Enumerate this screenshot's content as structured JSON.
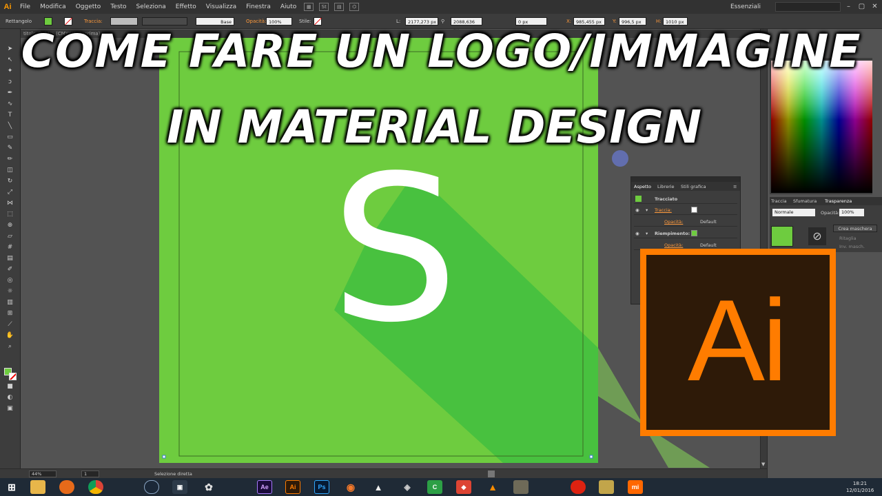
{
  "app": {
    "logo": "Ai"
  },
  "menu": [
    "File",
    "Modifica",
    "Oggetto",
    "Testo",
    "Seleziona",
    "Effetto",
    "Visualizza",
    "Finestra",
    "Aiuto"
  ],
  "workspace": "Essenziali",
  "control": {
    "tool_name": "Rettangolo",
    "stroke_label": "Traccia:",
    "brush_label": "Base",
    "opacity_label": "Opacità:",
    "opacity_value": "100%",
    "style_label": "Stile:",
    "width_label": "L:",
    "width_value": "2177,273 px",
    "height_value": "2088,636 px",
    "corner_value": "0 px",
    "x_label": "X:",
    "x_value": "985,455 px",
    "y_label": "Y:",
    "y_value": "996,5 px",
    "h_label": "H:",
    "h_value": "1010 px"
  },
  "tab": {
    "label": "titolo @ 44% (CMYK/Anteprima)"
  },
  "status": {
    "zoom": "44%",
    "page": "1",
    "selection": "Selezione diretta"
  },
  "appearance": {
    "tabs": [
      "Aspetto",
      "Librerie",
      "Stili grafica"
    ],
    "object": "Tracciato",
    "stroke": "Traccia:",
    "opacity": "Opacità:",
    "opacity_value": "Default",
    "fill": "Riempimento:",
    "opacity2": "Opacità:",
    "opacity2_value": "Default"
  },
  "transparency": {
    "tabs": [
      "Traccia",
      "Sfumatura",
      "Trasparenza"
    ],
    "mode": "Normale",
    "opacity_label": "Opacità:",
    "opacity_value": "100%",
    "mask_button": "Crea maschera",
    "clip": "Ritaglia",
    "invert": "Inv. masch."
  },
  "artwork": {
    "letter": "S",
    "bg_color": "#6ecc3f",
    "shadow_color": "#48c13f"
  },
  "overlay": {
    "line1": "COME FARE UN LOGO/IMMAGINE",
    "line2": "IN MATERIAL DESIGN"
  },
  "logo": {
    "text": "Ai",
    "color": "#ff7c00",
    "bg": "#2e1a08"
  },
  "taskbar": {
    "icons": [
      "windows-start",
      "file-explorer",
      "firefox",
      "chrome",
      "steam",
      "media-player",
      "davinci",
      "after-effects",
      "illustrator",
      "photoshop",
      "blender",
      "inkscape",
      "unity",
      "camtasia",
      "cs-go",
      "vlc",
      "gimp",
      "record",
      "filezilla",
      "xiaomi"
    ],
    "ae": "Ae",
    "ai": "Ai",
    "ps": "Ps",
    "mi": "mi",
    "time": "18:21",
    "date": "12/01/2016"
  }
}
